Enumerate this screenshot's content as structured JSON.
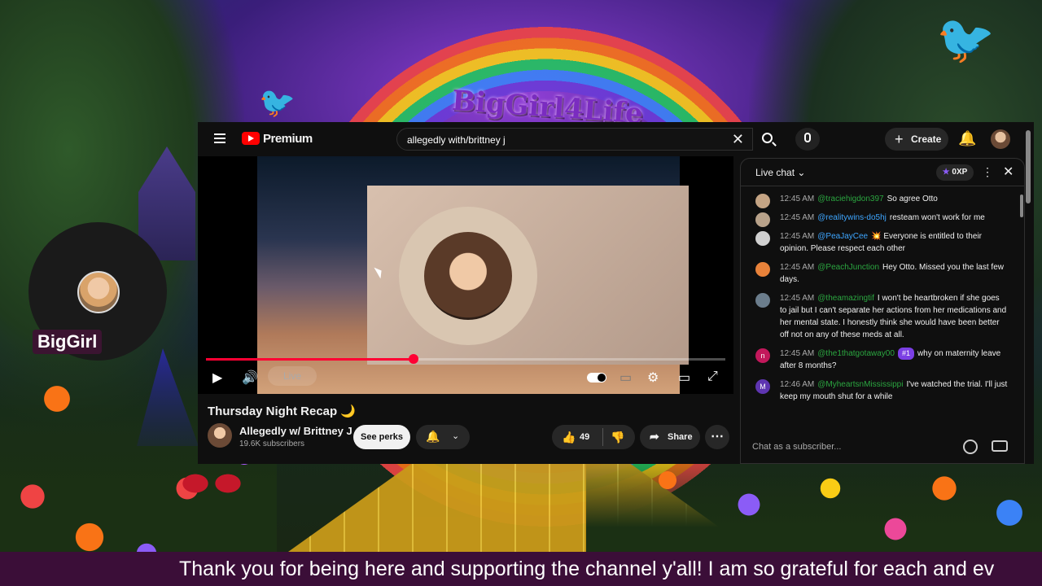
{
  "overlay": {
    "brand_title": "BigGirl4Life",
    "cam_name": "BigGirl",
    "ticker_text": "Thank you for being here and supporting the channel y'all! I am so grateful for each and ev"
  },
  "youtube": {
    "logo_text": "Premium",
    "search": {
      "value": "allegedly with/brittney j"
    },
    "create_label": "Create",
    "player": {
      "live_label": "Live",
      "progress": 0.4
    },
    "video": {
      "title": "Thursday Night Recap 🌙",
      "channel_name": "Allegedly w/ Brittney J",
      "subscribers": "19.6K subscribers",
      "perks_label": "See perks",
      "like_count": "49",
      "share_label": "Share"
    },
    "chat": {
      "title": "Live chat",
      "xp_label": "0XP",
      "input_placeholder": "Chat as a subscriber...",
      "messages": [
        {
          "time": "12:45 AM",
          "author": "@traciehigdon397",
          "text": "So agree Otto",
          "avatar_color": "#c4a484",
          "avatar_letter": ""
        },
        {
          "time": "12:45 AM",
          "author": "@realitywins-do5hj",
          "text": "resteam won't work for me",
          "avatar_color": "#b8a28a",
          "avatar_letter": ""
        },
        {
          "time": "12:45 AM",
          "author": "@PeaJayCee",
          "text": "💥 Everyone is entitled to their opinion. Please respect each other",
          "avatar_color": "#d0d0d0",
          "avatar_letter": ""
        },
        {
          "time": "12:45 AM",
          "author": "@PeachJunction",
          "text": "Hey Otto. Missed you the last few days.",
          "avatar_color": "#e8823a",
          "avatar_letter": ""
        },
        {
          "time": "12:45 AM",
          "author": "@theamazingtif",
          "text": "I won't be heartbroken if she goes to jail but I can't separate her actions from her medications and her mental state. I honestly think she would have been better off not on any of these meds at all.",
          "avatar_color": "#6b7d8c",
          "avatar_letter": ""
        },
        {
          "time": "12:45 AM",
          "author": "@the1thatgotaway00",
          "badge": "#1",
          "text": "why on maternity leave after 8 months?",
          "avatar_color": "#c2185b",
          "avatar_letter": "n"
        },
        {
          "time": "12:46 AM",
          "author": "@MyheartsnMississippi",
          "text": "I've watched the trial. I'll just keep my mouth shut for a while",
          "avatar_color": "#5e35b1",
          "avatar_letter": "M"
        }
      ]
    }
  },
  "colors": {
    "accent": "#ff0033",
    "member": "#2ba640",
    "ticker_bg": "#3b0e38"
  }
}
